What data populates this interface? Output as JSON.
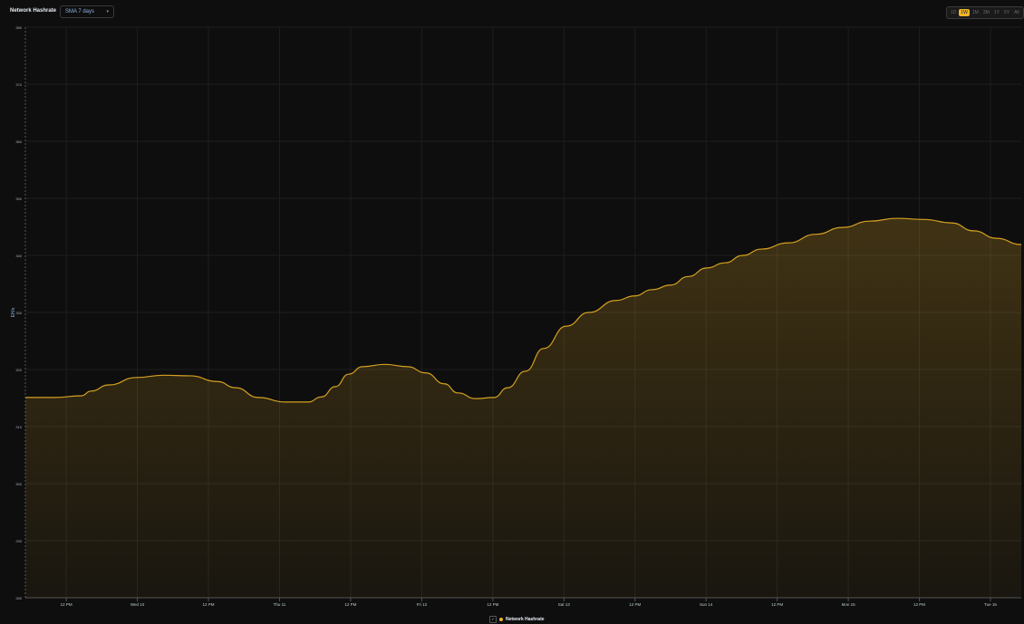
{
  "header": {
    "title": "Network Hashrate",
    "smoothing_select": "SMA 7 days",
    "chevron": "▾"
  },
  "range_buttons": [
    {
      "label": "1D",
      "active": false
    },
    {
      "label": "1W",
      "active": true
    },
    {
      "label": "1M",
      "active": false
    },
    {
      "label": "3M",
      "active": false
    },
    {
      "label": "1Y",
      "active": false
    },
    {
      "label": "5Y",
      "active": false
    },
    {
      "label": "All",
      "active": false
    }
  ],
  "legend": {
    "checkbox": "✓",
    "label": "Network Hashrate"
  },
  "colors": {
    "line": "#d4a020",
    "accent": "#f0b429"
  },
  "chart_data": {
    "type": "area",
    "title": "Network Hashrate",
    "ylabel": "EH/s",
    "xlabel": "",
    "ylim": [
      280,
      380
    ],
    "yticks": [
      380,
      370,
      360,
      350,
      340,
      330,
      320,
      310,
      300,
      290,
      280
    ],
    "xlim_hours": [
      5.1,
      173.2
    ],
    "xticks": [
      {
        "h": 12,
        "label": "12 PM"
      },
      {
        "h": 24,
        "label": "Wed 10"
      },
      {
        "h": 36,
        "label": "12 PM"
      },
      {
        "h": 48,
        "label": "Thu 11"
      },
      {
        "h": 60,
        "label": "12 PM"
      },
      {
        "h": 72,
        "label": "Fri 12"
      },
      {
        "h": 84,
        "label": "12 PM"
      },
      {
        "h": 96,
        "label": "Sat 13"
      },
      {
        "h": 108,
        "label": "12 PM"
      },
      {
        "h": 120,
        "label": "Sun 14"
      },
      {
        "h": 132,
        "label": "12 PM"
      },
      {
        "h": 144,
        "label": "Mon 15"
      },
      {
        "h": 156,
        "label": "12 PM"
      },
      {
        "h": 168,
        "label": "Tue 16"
      }
    ],
    "grid": true,
    "legend_position": "bottom-center",
    "series": [
      {
        "name": "Network Hashrate",
        "x": [
          5.1,
          10.0,
          14.6,
          16.1,
          19.2,
          23.8,
          28.4,
          32.9,
          37.5,
          40.6,
          44.4,
          49.0,
          52.8,
          55.1,
          57.4,
          59.7,
          62.0,
          65.8,
          69.6,
          72.7,
          75.8,
          78.1,
          81.1,
          84.2,
          86.5,
          89.5,
          92.6,
          96.4,
          100.2,
          104.8,
          107.9,
          110.9,
          114.0,
          117.0,
          120.1,
          123.2,
          126.2,
          129.3,
          133.9,
          138.5,
          143.0,
          147.6,
          152.2,
          156.8,
          161.4,
          165.2,
          169.0,
          173.2
        ],
        "values": [
          315.1,
          315.1,
          315.4,
          316.2,
          317.3,
          318.6,
          319.0,
          318.9,
          317.9,
          316.8,
          315.1,
          314.3,
          314.3,
          315.2,
          317.0,
          319.2,
          320.5,
          320.9,
          320.5,
          319.4,
          317.5,
          315.9,
          314.9,
          315.1,
          316.8,
          319.7,
          323.7,
          327.6,
          330.0,
          332.1,
          332.9,
          334.0,
          334.8,
          336.3,
          337.8,
          338.7,
          340.0,
          341.1,
          342.2,
          343.7,
          344.9,
          346.0,
          346.5,
          346.3,
          345.7,
          344.3,
          343.0,
          341.9
        ]
      }
    ]
  }
}
